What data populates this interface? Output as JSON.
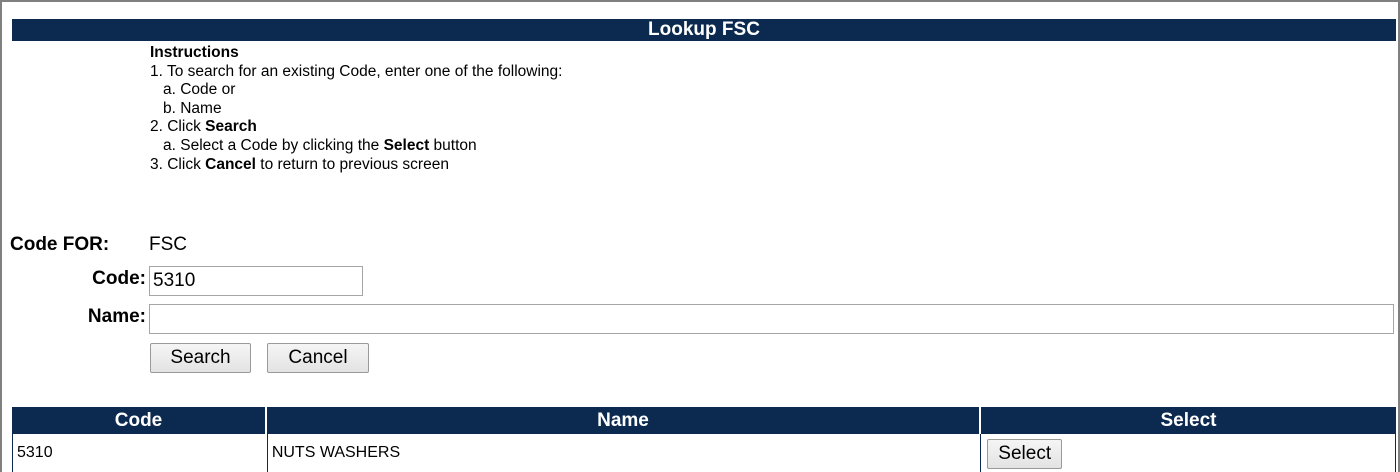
{
  "title": "Lookup FSC",
  "instructions": {
    "heading": "Instructions",
    "line1": "1. To search for an existing Code, enter one of the following:",
    "line1a": "a. Code or",
    "line1b": "b. Name",
    "line2_prefix": "2. Click ",
    "line2_bold": "Search",
    "line2a_prefix": "a. Select a Code by clicking the ",
    "line2a_bold": "Select",
    "line2a_suffix": " button",
    "line3_prefix": "3. Click ",
    "line3_bold": "Cancel",
    "line3_suffix": " to return to previous screen"
  },
  "form": {
    "code_for_label": "Code FOR:",
    "code_for_value": "FSC",
    "code_label": "Code:",
    "code_value": "5310",
    "name_label": "Name:",
    "name_value": "",
    "search_label": "Search",
    "cancel_label": "Cancel"
  },
  "results": {
    "columns": [
      "Code",
      "Name",
      "Select"
    ],
    "rows": [
      {
        "code": "5310",
        "name": "NUTS WASHERS",
        "select_label": "Select"
      }
    ]
  },
  "colors": {
    "header_bg": "#0c2a4f",
    "header_text": "#ffffff"
  }
}
